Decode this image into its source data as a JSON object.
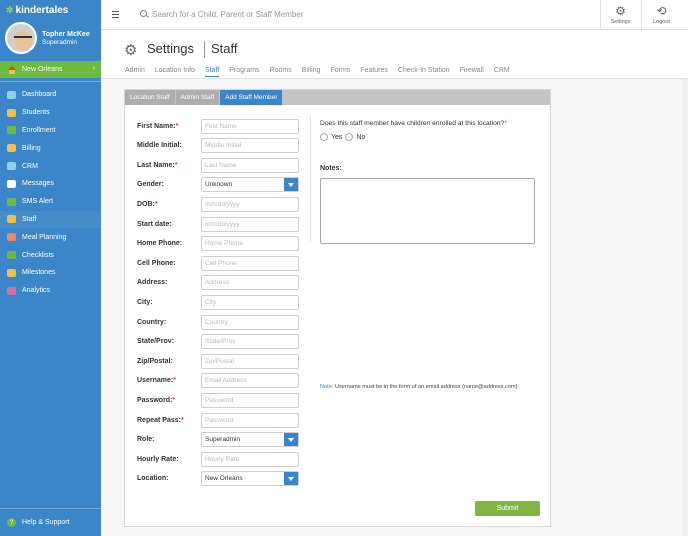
{
  "app": {
    "logo": "kindertales",
    "user_name": "Topher McKee",
    "user_role": "Superadmin",
    "location": "New Orleans"
  },
  "sidebar": {
    "items": [
      {
        "label": "Dashboard",
        "icon": "dashboard-icon",
        "color": "#8fd0f0"
      },
      {
        "label": "Students",
        "icon": "students-icon",
        "color": "#f1c14c"
      },
      {
        "label": "Enrollment",
        "icon": "enrollment-icon",
        "color": "#6cba3f"
      },
      {
        "label": "Billing",
        "icon": "billing-icon",
        "color": "#f1c14c"
      },
      {
        "label": "CRM",
        "icon": "crm-icon",
        "color": "#8fd0f0"
      },
      {
        "label": "Messages",
        "icon": "messages-icon",
        "color": "#ffffff"
      },
      {
        "label": "SMS Alert",
        "icon": "sms-alert-icon",
        "color": "#6cba3f"
      },
      {
        "label": "Staff",
        "icon": "staff-icon",
        "color": "#f1c14c"
      },
      {
        "label": "Meal Planning",
        "icon": "meal-planning-icon",
        "color": "#f08a5d"
      },
      {
        "label": "Checklists",
        "icon": "checklists-icon",
        "color": "#6cba3f"
      },
      {
        "label": "Milestones",
        "icon": "milestones-icon",
        "color": "#f1c14c"
      },
      {
        "label": "Analytics",
        "icon": "analytics-icon",
        "color": "#e06b9a"
      }
    ],
    "help_label": "Help & Support"
  },
  "topbar": {
    "search_placeholder": "Search for a Child, Parent or Staff Member",
    "settings_label": "Settings",
    "logout_label": "Logout"
  },
  "header": {
    "title": "Settings",
    "subtitle": "Staff",
    "tabs": [
      "Admin",
      "Location Info",
      "Staff",
      "Programs",
      "Rooms",
      "Billing",
      "Forms",
      "Features",
      "Check-In Station",
      "Firewall",
      "CRM"
    ],
    "active_tab": "Staff"
  },
  "panel": {
    "tabs": [
      "Location Staff",
      "Admin Staff",
      "Add Staff Member"
    ],
    "active_tab": "Add Staff Member"
  },
  "form": {
    "fields": [
      {
        "label": "First Name:",
        "required": true,
        "placeholder": "First Name"
      },
      {
        "label": "Middle Initial:",
        "required": false,
        "placeholder": "Middle Initial"
      },
      {
        "label": "Last Name:",
        "required": true,
        "placeholder": "Last Name"
      },
      {
        "label": "Gender:",
        "required": false,
        "select": "Unknown"
      },
      {
        "label": "DOB:",
        "required": true,
        "placeholder": "mm/dd/yyyy"
      },
      {
        "label": "Start date:",
        "required": false,
        "placeholder": "mm/dd/yyyy"
      },
      {
        "label": "Home Phone:",
        "required": false,
        "placeholder": "Home Phone"
      },
      {
        "label": "Cell Phone:",
        "required": false,
        "placeholder": "Cell Phone"
      },
      {
        "label": "Address:",
        "required": false,
        "placeholder": "Address"
      },
      {
        "label": "City:",
        "required": false,
        "placeholder": "City"
      },
      {
        "label": "Country:",
        "required": false,
        "placeholder": "Country"
      },
      {
        "label": "State/Prov:",
        "required": false,
        "placeholder": "State/Prov"
      },
      {
        "label": "Zip/Postal:",
        "required": false,
        "placeholder": "Zip/Postal"
      },
      {
        "label": "Username:",
        "required": true,
        "placeholder": "Email Address"
      },
      {
        "label": "Password:",
        "required": true,
        "placeholder": "Password"
      },
      {
        "label": "Repeat Pass:",
        "required": true,
        "placeholder": "Password"
      },
      {
        "label": "Role:",
        "required": false,
        "select": "Superadmin"
      },
      {
        "label": "Hourly Rate:",
        "required": false,
        "placeholder": "Hourly Rate"
      },
      {
        "label": "Location:",
        "required": false,
        "select": "New Orleans"
      }
    ],
    "children_question": "Does this staff member have children enrolled at this location?",
    "yes_label": "Yes",
    "no_label": "No",
    "notes_label": "Notes:",
    "note_prefix": "Note:",
    "note_text": "Username must be in the form of an email address (name@address.com)",
    "submit_label": "Submit"
  }
}
